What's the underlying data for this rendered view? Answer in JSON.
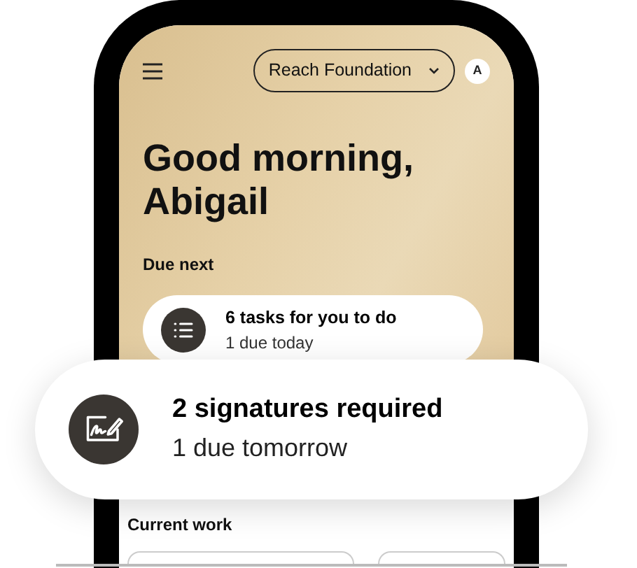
{
  "header": {
    "organization": "Reach Foundation",
    "avatar": "A"
  },
  "greeting": "Good morning, Abigail",
  "due_next": {
    "title": "Due next",
    "cards": [
      {
        "kind": "tasks",
        "title": "6 tasks for you to do",
        "subtitle": "1 due today"
      },
      {
        "kind": "signatures",
        "title": "2 signatures required",
        "subtitle": "1 due tomorrow"
      }
    ]
  },
  "current_work": {
    "title": "Current work"
  }
}
